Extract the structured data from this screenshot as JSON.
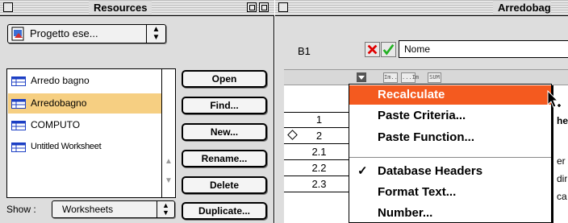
{
  "resources_window": {
    "title": "Resources",
    "project_popup": {
      "value": "Progetto ese...",
      "arrows": "▲▼"
    },
    "worksheet_list": [
      {
        "name": "Arredo bagno",
        "selected": false
      },
      {
        "name": "Arredobagno",
        "selected": true
      },
      {
        "name": "COMPUTO",
        "selected": false
      },
      {
        "name": "Untitled Worksheet",
        "selected": false
      }
    ],
    "buttons": {
      "open": "Open",
      "find": "Find...",
      "new": "New...",
      "rename": "Rename...",
      "delete": "Delete",
      "duplicate": "Duplicate..."
    },
    "show_label": "Show :",
    "show_popup": {
      "value": "Worksheets",
      "arrows": "▲▼"
    }
  },
  "worksheet_window": {
    "title": "Arredobag",
    "cell_reference": "B1",
    "entry_value": "Nome",
    "toolbar_icons": [
      "text-format-icon",
      "field-format-icon",
      "sum-icon"
    ],
    "toolbar_icon_labels": [
      "Im..",
      "...Im",
      "SUM"
    ],
    "rows": [
      {
        "label": ""
      },
      {
        "label": "1"
      },
      {
        "label": "2",
        "marker": true
      },
      {
        "label": "2.1"
      },
      {
        "label": "2.2"
      },
      {
        "label": "2.3"
      }
    ],
    "cell_fragments": [
      "he",
      "er",
      "dir",
      "ca"
    ]
  },
  "context_menu": {
    "items": [
      {
        "label": "Recalculate",
        "highlighted": true,
        "checked": false
      },
      {
        "label": "Paste Criteria...",
        "highlighted": false,
        "checked": false
      },
      {
        "label": "Paste Function...",
        "highlighted": false,
        "checked": false
      },
      {
        "label": "Database Headers",
        "highlighted": false,
        "checked": true
      },
      {
        "label": "Format Text...",
        "highlighted": false,
        "checked": false
      },
      {
        "label": "Number...",
        "highlighted": false,
        "checked": false
      }
    ],
    "check_mark": "✓"
  },
  "colors": {
    "selection_highlight": "#f6cf82",
    "menu_highlight": "#f45a1f",
    "cancel_red": "#e00000",
    "ok_green": "#22b022",
    "worksheet_icon_blue": "#1c3fc4"
  }
}
